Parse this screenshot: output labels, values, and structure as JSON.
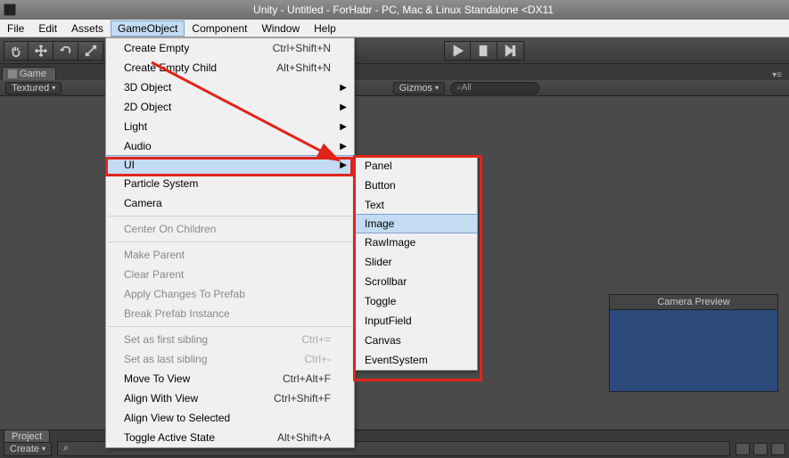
{
  "title": "Unity - Untitled - ForHabr - PC, Mac & Linux Standalone <DX11",
  "menubar": [
    "File",
    "Edit",
    "Assets",
    "GameObject",
    "Component",
    "Window",
    "Help"
  ],
  "menubar_active_index": 3,
  "game_tab": "Game",
  "subbar_textured": "Textured",
  "subbar_gizmos": "Gizmos",
  "subbar_search": "All",
  "project_tab": "Project",
  "create_btn": "Create",
  "camera_preview": "Camera Preview",
  "menu": {
    "items": [
      {
        "label": "Create Empty",
        "shortcut": "Ctrl+Shift+N",
        "sub": false
      },
      {
        "label": "Create Empty Child",
        "shortcut": "Alt+Shift+N",
        "sub": false
      },
      {
        "label": "3D Object",
        "sub": true
      },
      {
        "label": "2D Object",
        "sub": true
      },
      {
        "label": "Light",
        "sub": true
      },
      {
        "label": "Audio",
        "sub": true
      },
      {
        "label": "UI",
        "sub": true,
        "highlight": true
      },
      {
        "label": "Particle System",
        "sub": false
      },
      {
        "label": "Camera",
        "sub": false
      },
      {
        "sep": true
      },
      {
        "label": "Center On Children",
        "disabled": true
      },
      {
        "sep": true
      },
      {
        "label": "Make Parent",
        "disabled": true
      },
      {
        "label": "Clear Parent",
        "disabled": true
      },
      {
        "label": "Apply Changes To Prefab",
        "disabled": true
      },
      {
        "label": "Break Prefab Instance",
        "disabled": true
      },
      {
        "sep": true
      },
      {
        "label": "Set as first sibling",
        "shortcut": "Ctrl+=",
        "disabled": true
      },
      {
        "label": "Set as last sibling",
        "shortcut": "Ctrl+-",
        "disabled": true
      },
      {
        "label": "Move To View",
        "shortcut": "Ctrl+Alt+F"
      },
      {
        "label": "Align With View",
        "shortcut": "Ctrl+Shift+F"
      },
      {
        "label": "Align View to Selected"
      },
      {
        "label": "Toggle Active State",
        "shortcut": "Alt+Shift+A"
      }
    ]
  },
  "submenu": {
    "items": [
      "Panel",
      "Button",
      "Text",
      "Image",
      "RawImage",
      "Slider",
      "Scrollbar",
      "Toggle",
      "InputField",
      "Canvas",
      "EventSystem"
    ],
    "highlight_index": 3
  }
}
